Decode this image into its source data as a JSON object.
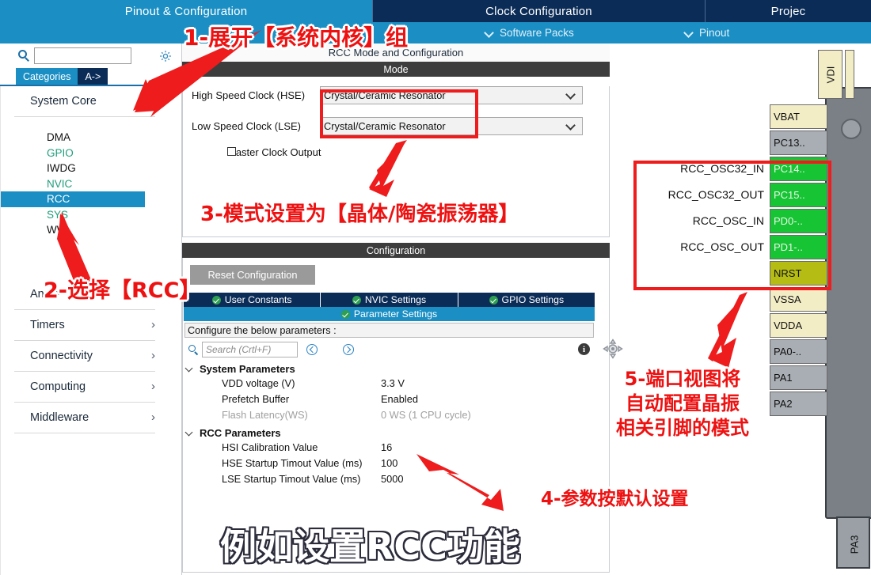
{
  "topbar": {
    "tabs": [
      {
        "label": "Pinout & Configuration",
        "active": true
      },
      {
        "label": "Clock Configuration",
        "active": false
      },
      {
        "label": "Projec",
        "active": false
      }
    ],
    "subtabs": [
      {
        "label": "Software Packs"
      },
      {
        "label": "Pinout"
      }
    ]
  },
  "sidebar": {
    "search_value": "",
    "search_icon": "search-icon",
    "gear_icon": "gear-icon",
    "cat_tabs": [
      {
        "label": "Categories",
        "active": true
      },
      {
        "label": "A->",
        "active": false
      }
    ],
    "groups": [
      {
        "label": "System Core",
        "expanded": true,
        "items": [
          {
            "label": "DMA",
            "state": "plain"
          },
          {
            "label": "GPIO",
            "state": "green"
          },
          {
            "label": "IWDG",
            "state": "plain"
          },
          {
            "label": "NVIC",
            "state": "green"
          },
          {
            "label": "RCC",
            "state": "selected"
          },
          {
            "label": "SYS",
            "state": "green"
          },
          {
            "label": "WW",
            "state": "plain"
          }
        ]
      },
      {
        "label": "Analo",
        "expanded": false,
        "caret": "›"
      },
      {
        "label": "Timers",
        "expanded": false,
        "caret": "›"
      },
      {
        "label": "Connectivity",
        "expanded": false,
        "caret": "›"
      },
      {
        "label": "Computing",
        "expanded": false,
        "caret": "›"
      },
      {
        "label": "Middleware",
        "expanded": false,
        "caret": "›"
      }
    ]
  },
  "center": {
    "panel_title": "RCC Mode and Configuration",
    "mode": {
      "band_label": "Mode",
      "rows": [
        {
          "label": "High Speed Clock (HSE)",
          "value": "Crystal/Ceramic Resonator"
        },
        {
          "label": "Low Speed Clock (LSE)",
          "value": "Crystal/Ceramic Resonator"
        }
      ],
      "checkbox_label": "Master Clock Output",
      "checkbox_checked": false
    },
    "configuration": {
      "band_label": "Configuration",
      "reset_button": "Reset Configuration",
      "tabs": [
        {
          "label": "User Constants",
          "checked": true
        },
        {
          "label": "NVIC Settings",
          "checked": true
        },
        {
          "label": "GPIO Settings",
          "checked": true
        }
      ],
      "active_tab": {
        "label": "Parameter Settings",
        "checked": true
      },
      "configure_line": "Configure the below parameters :",
      "search_placeholder": "Search (Crtl+F)",
      "search_value": "",
      "prev_icon": "prev-icon",
      "next_icon": "next-icon",
      "info_icon": "info-icon",
      "param_groups": [
        {
          "label": "System Parameters",
          "rows": [
            {
              "name": "VDD voltage (V)",
              "value": "3.3 V",
              "dim": false
            },
            {
              "name": "Prefetch Buffer",
              "value": "Enabled",
              "dim": false
            },
            {
              "name": "Flash Latency(WS)",
              "value": "0 WS (1 CPU cycle)",
              "dim": true
            }
          ]
        },
        {
          "label": "RCC Parameters",
          "rows": [
            {
              "name": "HSI Calibration Value",
              "value": "16",
              "dim": false
            },
            {
              "name": "HSE Startup Timout Value (ms)",
              "value": "100",
              "dim": false
            },
            {
              "name": "LSE Startup Timout Value (ms)",
              "value": "5000",
              "dim": false
            }
          ]
        }
      ]
    }
  },
  "pinview": {
    "top_pin": "VDI",
    "chip_bottom_label": "PA3",
    "pins": [
      {
        "name": "VBAT",
        "color": "cream",
        "label": ""
      },
      {
        "name": "PC13..",
        "color": "grey",
        "label": ""
      },
      {
        "name": "PC14..",
        "color": "green",
        "label": "RCC_OSC32_IN"
      },
      {
        "name": "PC15..",
        "color": "green",
        "label": "RCC_OSC32_OUT"
      },
      {
        "name": "PD0-..",
        "color": "green",
        "label": "RCC_OSC_IN"
      },
      {
        "name": "PD1-..",
        "color": "green",
        "label": "RCC_OSC_OUT"
      },
      {
        "name": "NRST",
        "color": "olive",
        "label": ""
      },
      {
        "name": "VSSA",
        "color": "cream",
        "label": ""
      },
      {
        "name": "VDDA",
        "color": "cream",
        "label": ""
      },
      {
        "name": "PA0-..",
        "color": "grey",
        "label": ""
      },
      {
        "name": "PA1",
        "color": "grey",
        "label": ""
      },
      {
        "name": "PA2",
        "color": "grey",
        "label": ""
      }
    ]
  },
  "annotations": {
    "step1": "1-展开【系统内核】组",
    "step2": "2-选择【RCC】",
    "step3": "3-模式设置为【晶体/陶瓷振荡器】",
    "step4": "4-参数按默认设置",
    "step5_line1": "5-端口视图将",
    "step5_line2": "自动配置晶振",
    "step5_line3": "相关引脚的模式",
    "caption": "例如设置RCC功能"
  },
  "colors": {
    "accent_blue": "#1b8fc4",
    "dark_navy": "#0b2c57",
    "annotation_red": "#ee1111",
    "pin_green": "#17c434",
    "pin_cream": "#f3edc6",
    "pin_olive": "#b5bd14",
    "pin_grey": "#a9aeb4"
  }
}
